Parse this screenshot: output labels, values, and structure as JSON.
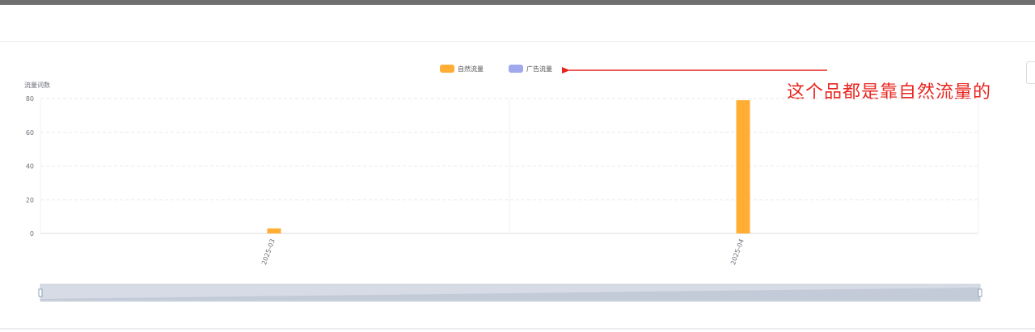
{
  "chart_data": {
    "type": "bar",
    "categories": [
      "2025-03",
      "2025-04"
    ],
    "series": [
      {
        "name": "自然流量",
        "values": [
          3,
          79
        ],
        "color": "#ffad33"
      },
      {
        "name": "广告流量",
        "values": [
          0,
          0
        ],
        "color": "#a0a8ee"
      }
    ],
    "ylabel": "流量词数",
    "ylim": [
      0,
      80
    ],
    "yticks": [
      0,
      20,
      40,
      60,
      80
    ],
    "grid": true,
    "legend_position": "top-center",
    "x_tick_rotation": "vertical",
    "data_zoom": true
  },
  "annotation": {
    "text": "这个品都是靠自然流量的",
    "color": "#e8251f"
  }
}
